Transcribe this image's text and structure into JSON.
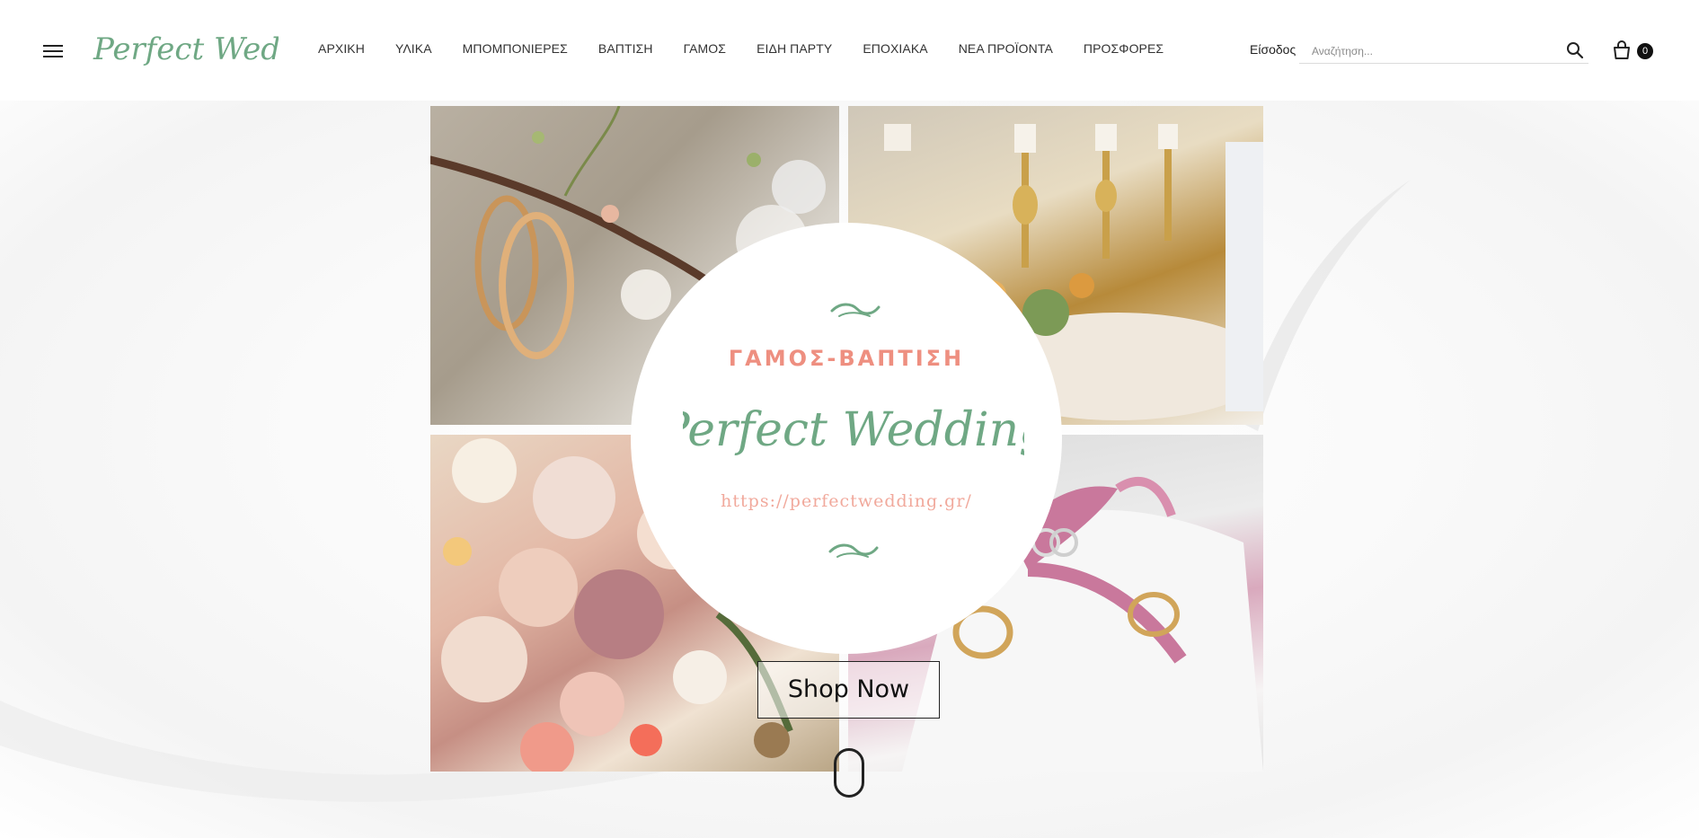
{
  "header": {
    "logo_text": "Perfect Wedding",
    "nav": [
      {
        "label": "ΑΡΧΙΚΗ"
      },
      {
        "label": "ΥΛΙΚΑ"
      },
      {
        "label": "ΜΠΟΜΠΟΝΙΕΡΕΣ"
      },
      {
        "label": "ΒΑΠΤΙΣΗ"
      },
      {
        "label": "ΓΑΜΟΣ"
      },
      {
        "label": "ΕΙΔΗ ΠΑΡΤΥ"
      },
      {
        "label": "ΕΠΟΧΙΑΚΑ"
      },
      {
        "label": "ΝΕΑ ΠΡΟΪΟΝΤΑ"
      },
      {
        "label": "ΠΡΟΣΦΟΡΕΣ"
      }
    ],
    "login_label": "Είσοδος",
    "search_placeholder": "Αναζήτηση...",
    "cart_count": "0"
  },
  "hero": {
    "subtitle": "ΓΑΜΟΣ-ΒΑΠΤΙΣΗ",
    "brand": "Perfect Wedding",
    "url": "https://perfectwedding.gr/",
    "cta_label": "Shop Now"
  },
  "colors": {
    "brand_green": "#6fa884",
    "accent_pink": "#ee8f80",
    "text_dark": "#222222"
  },
  "icons": [
    "menu-icon",
    "search-icon",
    "shopping-bag-icon",
    "scroll-mouse-icon"
  ]
}
